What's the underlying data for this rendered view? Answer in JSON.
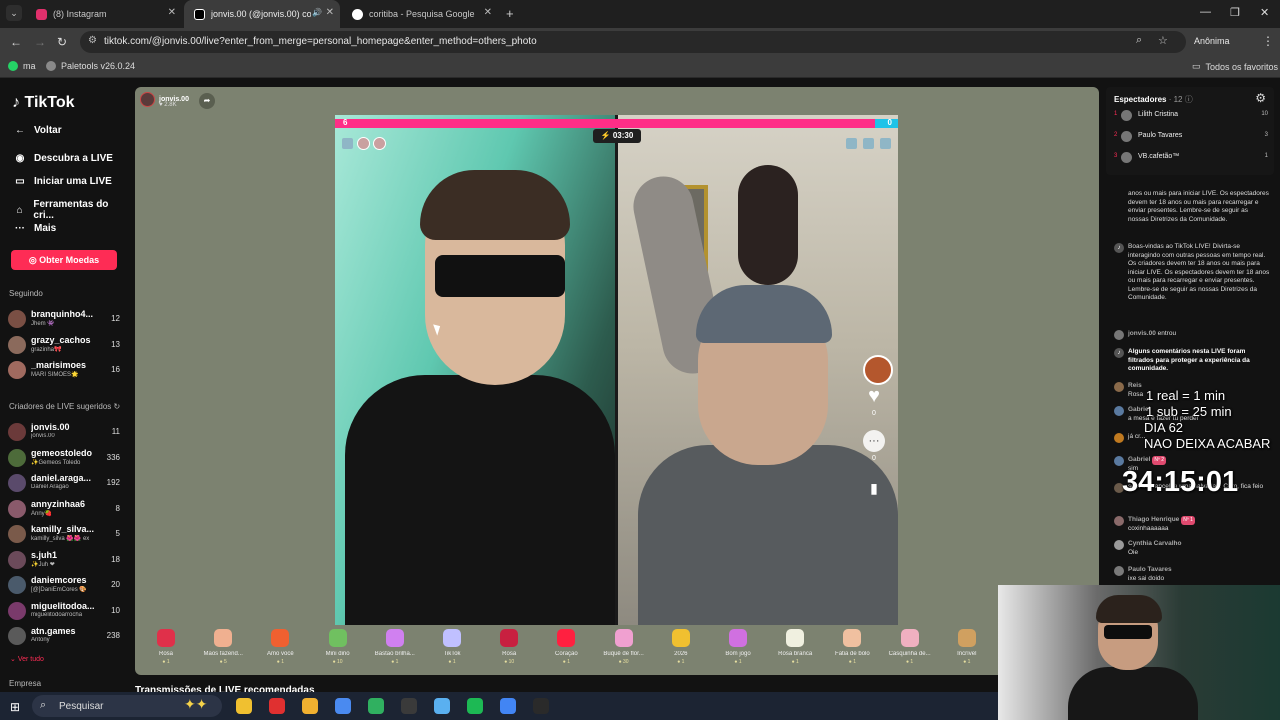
{
  "browser": {
    "tabs": [
      {
        "title": "(8) Instagram",
        "color": "#e1306c"
      },
      {
        "title": "jonvis.00 (@jonvis.00) come",
        "color": "#111111"
      },
      {
        "title": "coritiba - Pesquisa Google",
        "color": "#4285f4"
      }
    ],
    "url": "tiktok.com/@jonvis.00/live?enter_from_merge=personal_homepage&enter_method=others_photo",
    "profile_label": "Anônima",
    "bookmarks": [
      {
        "label": "ma",
        "color": "#25d366"
      },
      {
        "label": "Paletools v26.0.24",
        "color": "#8a8a8a"
      }
    ],
    "all_bookmarks": "Todos os favoritos"
  },
  "sidebar": {
    "logo": "TikTok",
    "back": "Voltar",
    "links": [
      {
        "label": "Descubra a LIVE",
        "icon": "live-avatar-icon"
      },
      {
        "label": "Iniciar uma LIVE",
        "icon": "camera-icon"
      },
      {
        "label": "Ferramentas do cri...",
        "icon": "home-icon"
      },
      {
        "label": "Mais",
        "icon": "more-icon"
      }
    ],
    "coins_button": "Obter Moedas",
    "following_title": "Seguindo",
    "following": [
      {
        "name": "branquinho4...",
        "sub": "Jhem 👾",
        "count": "12",
        "color": "#7a4f44"
      },
      {
        "name": "grazy_cachos",
        "sub": "grazinha🎀",
        "count": "13",
        "color": "#8b6a5c"
      },
      {
        "name": "_marisimoes",
        "sub": "MARI SIMÕES🌟",
        "count": "16",
        "color": "#a06a5f"
      }
    ],
    "creators_title": "Criadores de LIVE sugeridos",
    "creators": [
      {
        "name": "jonvis.00",
        "sub": "jonvis.00",
        "count": "11",
        "color": "#6b3a3a"
      },
      {
        "name": "gemeostoledo",
        "sub": "✨Gemeos Toledo",
        "count": "336",
        "color": "#4d6b3a"
      },
      {
        "name": "daniel.araga...",
        "sub": "Daniel Aragão",
        "count": "192",
        "color": "#5a4a6b"
      },
      {
        "name": "annyzinhaa6",
        "sub": "Anny🍓",
        "count": "8",
        "color": "#8a5a6b"
      },
      {
        "name": "kamilly_silva...",
        "sub": "kamilly_silva 🌺🌺 ex",
        "count": "5",
        "color": "#7a5a4a"
      },
      {
        "name": "s.juh1",
        "sub": "✨Juh ❤",
        "count": "18",
        "color": "#6b4a5a"
      },
      {
        "name": "daniemcores",
        "sub": "[@]DaniEmCores 🎨",
        "count": "20",
        "color": "#4a5a6b"
      },
      {
        "name": "miguelitodoa...",
        "sub": "miguelitodoarrocha",
        "count": "10",
        "color": "#7a3a6b"
      },
      {
        "name": "atn.games",
        "sub": "Antony",
        "count": "238",
        "color": "#5a5a5a"
      }
    ],
    "see_all": "Ver tudo",
    "company": "Empresa"
  },
  "stage": {
    "host_name": "jonvis.00",
    "host_likes": "2.8K",
    "score_left": "6",
    "score_right": "0",
    "score_left_fraction": 0.96,
    "timer": "03:30",
    "likes_count": "0",
    "comments_count": "0",
    "recommend_title": "Transmissões de LIVE recomendadas"
  },
  "gifts": [
    {
      "label": "Rosa",
      "price": "1",
      "color": "#e0304a"
    },
    {
      "label": "Mãos fazend...",
      "price": "5",
      "color": "#f0b090"
    },
    {
      "label": "Amo você",
      "price": "1",
      "color": "#f06030"
    },
    {
      "label": "Mini dino",
      "price": "10",
      "color": "#70c060"
    },
    {
      "label": "Bastão brilha...",
      "price": "1",
      "color": "#d080f0"
    },
    {
      "label": "TikTok",
      "price": "1",
      "color": "#c0c0ff"
    },
    {
      "label": "Rosa",
      "price": "10",
      "color": "#c82040"
    },
    {
      "label": "Coração",
      "price": "1",
      "color": "#ff2040"
    },
    {
      "label": "Buquê de flor...",
      "price": "30",
      "color": "#f0a0d0"
    },
    {
      "label": "2026",
      "price": "1",
      "color": "#f0c030"
    },
    {
      "label": "Bom jogo",
      "price": "1",
      "color": "#d070e0"
    },
    {
      "label": "Rosa branca",
      "price": "1",
      "color": "#f0f0e0"
    },
    {
      "label": "Fatia de bolo",
      "price": "1",
      "color": "#f0c0a0"
    },
    {
      "label": "Casquinha de...",
      "price": "1",
      "color": "#f0b0c0"
    },
    {
      "label": "Incrível",
      "price": "1",
      "color": "#d0a060"
    }
  ],
  "viewers": {
    "title": "Espectadores",
    "count": "12",
    "list": [
      {
        "rank": "1",
        "name": "Lilith Cristina",
        "score": "10"
      },
      {
        "rank": "2",
        "name": "Paulo Tavares",
        "score": "3"
      },
      {
        "rank": "3",
        "name": "VB.cafetão™",
        "score": "1"
      }
    ]
  },
  "chat": {
    "msg1": "anos ou mais para iniciar LIVE. Os espectadores devem ter 18 anos ou mais para recarregar e enviar presentes. Lembre-se de seguir as nossas Diretrizes da Comunidade.",
    "msg2": "Boas-vindas ao TikTok LIVE! Divirta-se interagindo com outras pessoas em tempo real. Os criadores devem ter 18 anos ou mais para iniciar LIVE. Os espectadores devem ter 18 anos ou mais para recarregar e enviar presentes. Lembre-se de seguir as nossas Diretrizes da Comunidade.",
    "join_user": "jonvis.00",
    "join_text": "entrou",
    "msg3": "Alguns comentários nesta LIVE foram filtrados para proteger a experiência da comunidade.",
    "c1_user": "Reis",
    "c1_text": "Rosa",
    "c2_user": "Gabriel",
    "c2_text": "a mesa é fazer tu perder",
    "c3_text": "já cr...",
    "c4_user": "Gabriel",
    "c4_level": "Nº 2",
    "c4_text": "sim",
    "c5_text": "sem sobrancelha uma salvada... Com, fica feio",
    "c6_user": "Thiago Henrique",
    "c6_level": "Nº 1",
    "c6_text": "coxinhaaaaaa",
    "c7_user": "Cynthia Carvalho",
    "c7_text": "Oie",
    "c8_user": "Paulo Tavares",
    "c8_text": "ixe sai doido"
  },
  "overlay": {
    "line1": "1 real = 1 min",
    "line2": "1 sub = 25 min",
    "line3": "DIA 62",
    "line4": "NAO DEIXA ACABAR",
    "countdown": "34:15:01"
  },
  "taskbar": {
    "search_label": "Pesquisar",
    "apps": [
      "#f0c030",
      "#e03030",
      "#f0b030",
      "#4a8af0",
      "#30b060",
      "#3a3a3a",
      "#5ab0f0",
      "#1db954",
      "#4285f4",
      "#2a2a2a"
    ]
  }
}
